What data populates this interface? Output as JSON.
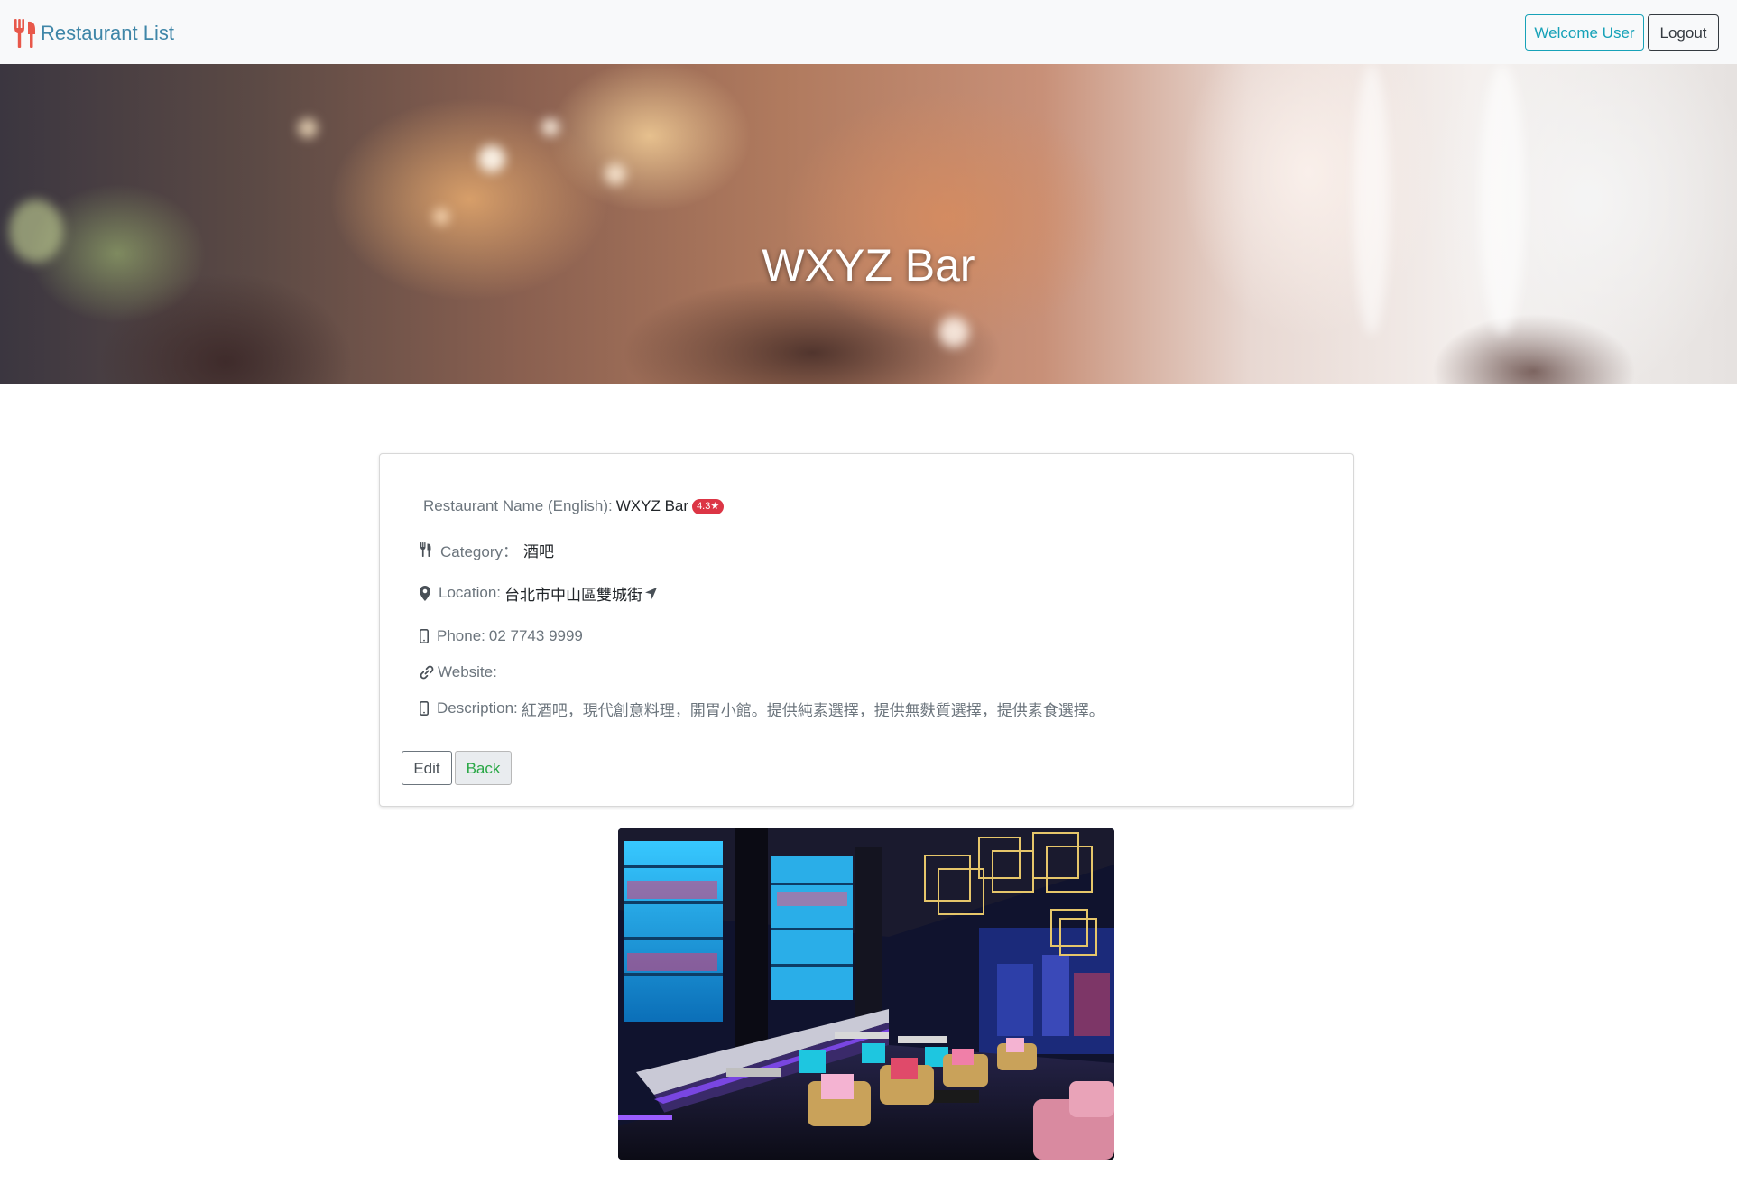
{
  "navbar": {
    "brand": "Restaurant List",
    "welcome_label": "Welcome User",
    "logout_label": "Logout"
  },
  "hero": {
    "title": "WXYZ Bar"
  },
  "detail": {
    "name_label": "Restaurant Name (English):",
    "name_value": "WXYZ Bar",
    "rating": "4.3",
    "category_label": "Category：",
    "category_value": "酒吧",
    "location_label": "Location:",
    "location_value": "台北市中山區雙城街",
    "phone_label": "Phone:",
    "phone_value": "02 7743 9999",
    "website_label": "Website:",
    "website_value": "",
    "description_label": "Description:",
    "description_value": "紅酒吧，現代創意料理，開胃小館。提供純素選擇，提供無麩質選擇，提供素食選擇。",
    "edit_label": "Edit",
    "back_label": "Back"
  },
  "colors": {
    "brand": "#3f86a8",
    "brand_icon": "#e8584a",
    "welcome_border": "#17a2b8",
    "badge": "#dc3545",
    "back_text": "#28a745"
  },
  "icons": {
    "brand": "utensils-icon",
    "category": "utensils-icon",
    "location": "map-marker-icon",
    "location_link": "location-arrow-icon",
    "phone": "mobile-phone-icon",
    "website": "link-icon",
    "description": "mobile-phone-icon",
    "rating": "star-icon"
  }
}
